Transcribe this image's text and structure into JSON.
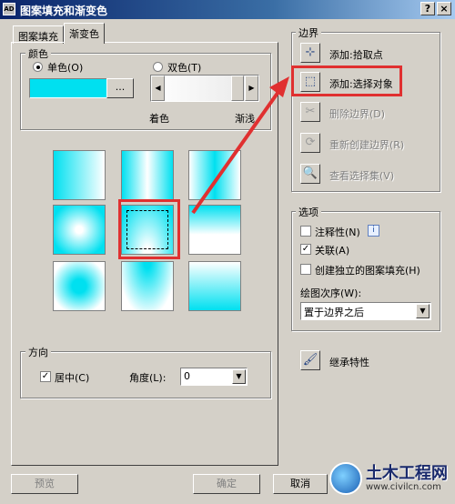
{
  "window": {
    "title": "图案填充和渐变色",
    "help_label": "?",
    "close_label": "×"
  },
  "tabs": [
    {
      "label": "图案填充"
    },
    {
      "label": "渐变色"
    }
  ],
  "color": {
    "group_label": "颜色",
    "single_label": "单色(O)",
    "double_label": "双色(T)",
    "swatch_color": "#00e0f0",
    "browse_label": "...",
    "shade_label": "着色",
    "tint_label": "渐浅"
  },
  "gradient_tiles": [
    "linear-h",
    "cylinder-h",
    "inv-cylinder-h",
    "spherical",
    "hemispherical",
    "curved",
    "inv-spherical",
    "inv-hemispherical",
    "inv-curved"
  ],
  "orientation": {
    "group_label": "方向",
    "centered_label": "居中(C)",
    "angle_label": "角度(L):",
    "angle_value": "0"
  },
  "boundaries": {
    "group_label": "边界",
    "add_pick_points": "添加:拾取点",
    "add_select_objects": "添加:选择对象",
    "remove_boundaries": "删除边界(D)",
    "recreate_boundary": "重新创建边界(R)",
    "view_selections": "查看选择集(V)"
  },
  "options": {
    "group_label": "选项",
    "annotative_label": "注释性(N)",
    "associative_label": "关联(A)",
    "independent_label": "创建独立的图案填充(H)",
    "draw_order_label": "绘图次序(W):",
    "draw_order_value": "置于边界之后"
  },
  "inherit_label": "继承特性",
  "footer": {
    "preview": "预览",
    "ok": "确定",
    "cancel": "取消"
  },
  "watermark": {
    "name": "土木工程网",
    "url": "www.civilcn.com"
  },
  "accent": {
    "highlight_red": "#e03030",
    "cyan": "#00e0f0"
  }
}
